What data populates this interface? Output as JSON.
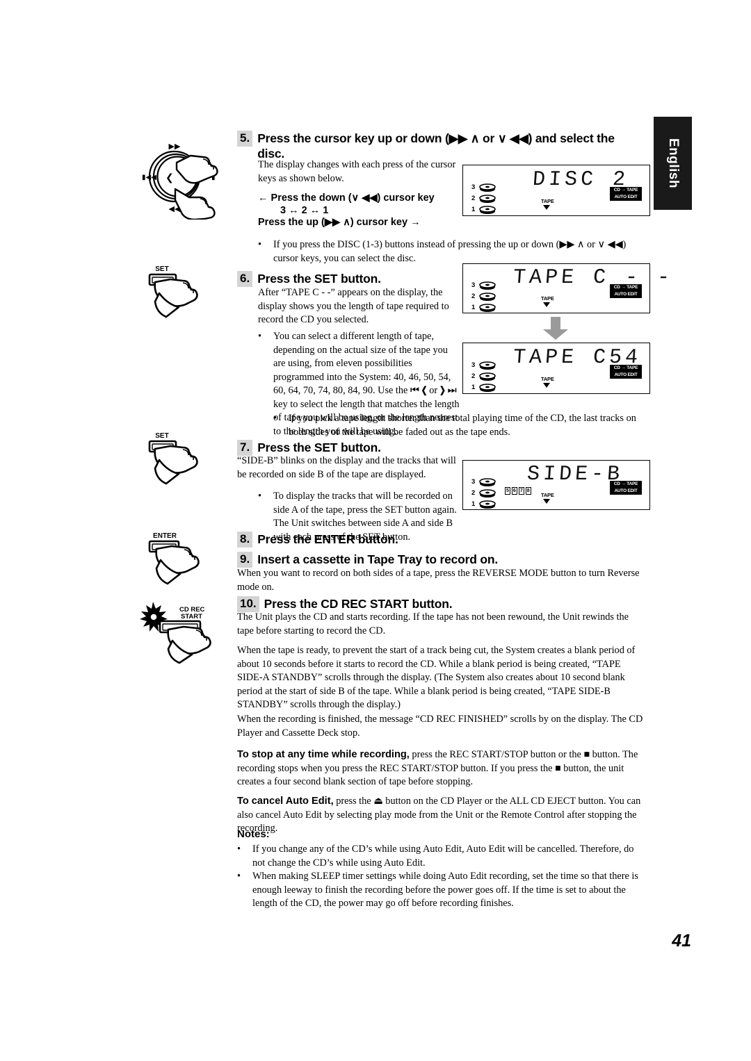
{
  "page": {
    "number": "41",
    "language_tab": "English"
  },
  "steps": [
    {
      "num": "5.",
      "title": "Press the cursor key up or down (▶▶ ∧ or ∨ ◀◀) and select the disc."
    },
    {
      "num": "6.",
      "title": "Press the SET button."
    },
    {
      "num": "7.",
      "title": "Press the SET button."
    },
    {
      "num": "8.",
      "title": "Press the ENTER button."
    },
    {
      "num": "9.",
      "title": "Insert a cassette in Tape Tray to record on."
    },
    {
      "num": "10.",
      "title": "Press the CD REC START button."
    }
  ],
  "body": {
    "s5_intro": "The display changes with each press of the cursor keys as shown below.",
    "s5_arrow_down": "← Press the down (∨ ◀◀) cursor key",
    "s5_sequence": "3 ↔ 2 ↔ 1",
    "s5_arrow_up": "Press the up (▶▶ ∧) cursor key →",
    "s5_bullet": "If you press the DISC (1-3) buttons instead of pressing the up or down (▶▶ ∧ or ∨ ◀◀) cursor keys, you can select the disc.",
    "s6_intro": "After “TAPE C - -” appears on the display, the display shows you the length of tape required to record the CD you selected.",
    "s6_bullet1": "You can select a different length of tape, depending on the actual size of the tape you are using, from eleven possibilities programmed into the System: 40, 46, 50, 54, 60, 64, 70, 74, 80, 84, 90. Use the ⏮ ❮ or ❯ ⏭ key to select the length that matches the length of tape you will be using, or the length nearest to the length you will be using.",
    "s6_bullet2": "If you pick a tape length shorter than the total playing time of the CD, the last tracks on both sides of the tape will be faded out as the tape ends.",
    "s7_intro": "“SIDE-B” blinks on the display and the tracks that will be recorded on side B of the tape are displayed.",
    "s7_bullet": "To display the tracks that will be recorded on side A of the tape, press the SET button again. The Unit switches between side A and side B with each press of the SET button.",
    "s9_intro": "When you want to record on both sides of a tape, press the REVERSE MODE button to turn Reverse mode on.",
    "s10_intro": "The Unit plays the CD and starts recording. If the tape has not been rewound, the Unit rewinds the tape before starting to record the CD.",
    "s10_p2": "When the tape is ready, to prevent the start of a track being cut, the System creates a blank period of about 10 seconds before it starts to record the CD. While a blank period is being created, “TAPE SIDE-A STANDBY” scrolls through the display. (The System also creates about 10 second blank period at the start of side B of the tape. While a blank period is being created, “TAPE SIDE-B STANDBY” scrolls through the display.)",
    "s10_p3": "When the recording is finished, the message “CD REC FINISHED” scrolls by on the display. The CD Player and Cassette Deck stop.",
    "stop_label": "To stop at any time while recording,",
    "stop_text": " press the REC START/STOP button or the ■ button. The recording stops when you press the REC START/STOP button.  If you press the ■ button, the unit creates a four second blank section of tape before stopping.",
    "cancel_label": "To cancel Auto Edit,",
    "cancel_text": " press the ⏏ button on the CD Player or the ALL CD EJECT button. You can also cancel Auto Edit by selecting play mode from the Unit or the Remote Control after stopping the recording.",
    "notes_heading": "Notes:",
    "note1": "If you change any of the CD’s while using Auto Edit, Auto Edit will be cancelled. Therefore, do not change the CD’s while using Auto Edit.",
    "note2": "When making SLEEP timer settings while doing Auto Edit recording, set the time so that there is enough leeway to finish the recording before the power goes off. If the time is set to about the length of the CD, the power may go off before recording finishes."
  },
  "illustrations": {
    "cursor_pad": {
      "up": "▶▶",
      "down": "◀◀",
      "left": "⏮◀◀",
      "right": "❯⏭",
      "center": "❮"
    },
    "set_button_1": "SET",
    "set_button_2": "SET",
    "enter_button": "ENTER",
    "cd_rec_start_line1": "CD REC",
    "cd_rec_start_line2": "START"
  },
  "displays": [
    {
      "id": "disc2",
      "main_text": "DISC 2",
      "disc_numbers": [
        "3",
        "2",
        "1"
      ],
      "tape_label": "TAPE",
      "badge_line1": "CD → TAPE",
      "badge_line2": "AUTO EDIT",
      "track_numbers": []
    },
    {
      "id": "tape-c-dashes",
      "main_text": "TAPE C - -",
      "disc_numbers": [
        "3",
        "2",
        "1"
      ],
      "tape_label": "TAPE",
      "badge_line1": "CD → TAPE",
      "badge_line2": "AUTO EDIT",
      "track_numbers": []
    },
    {
      "id": "tape-c54",
      "main_text": "TAPE C54",
      "disc_numbers": [
        "3",
        "2",
        "1"
      ],
      "tape_label": "TAPE",
      "badge_line1": "CD → TAPE",
      "badge_line2": "AUTO EDIT",
      "track_numbers": []
    },
    {
      "id": "side-b",
      "main_text": "SIDE-B",
      "disc_numbers": [
        "3",
        "2",
        "1"
      ],
      "tape_label": "TAPE",
      "badge_line1": "CD → TAPE",
      "badge_line2": "AUTO EDIT",
      "track_numbers": [
        "5",
        "6",
        "7",
        "8"
      ]
    }
  ],
  "colors": {
    "step_badge_bg": "#d4d4d4",
    "tab_bg": "#1a1a1a",
    "ink": "#000000"
  }
}
